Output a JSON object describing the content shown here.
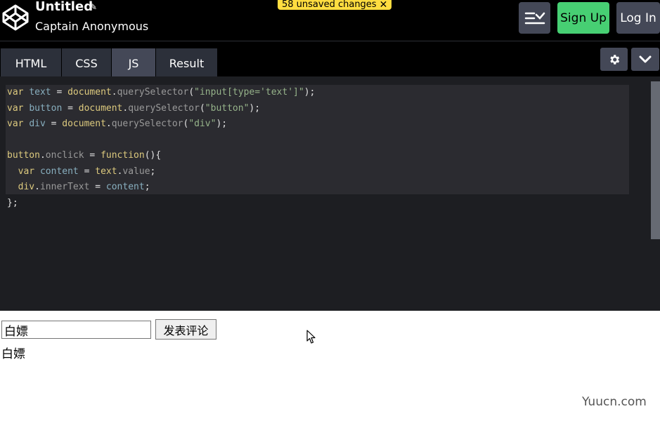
{
  "header": {
    "title": "Untitled",
    "author": "Captain Anonymous",
    "unsaved_label": "58 unsaved changes",
    "signup_label": "Sign Up",
    "login_label": "Log In"
  },
  "tabs": [
    {
      "label": "HTML"
    },
    {
      "label": "CSS"
    },
    {
      "label": "JS"
    },
    {
      "label": "Result"
    }
  ],
  "result": {
    "input_value": "白嫖",
    "button_label": "发表评论",
    "output_text": "白嫖"
  },
  "watermark": "Yuucn.com",
  "colors": {
    "signup": "#47cf73",
    "unsaved_badge": "#ffdd40",
    "editor_bg": "#1d1e22"
  }
}
